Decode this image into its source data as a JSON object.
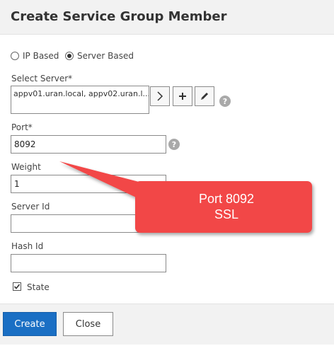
{
  "dialog": {
    "title": "Create Service Group Member"
  },
  "type_selector": {
    "options": [
      {
        "label": "IP Based",
        "selected": false
      },
      {
        "label": "Server Based",
        "selected": true
      }
    ]
  },
  "select_server": {
    "label": "Select Server*",
    "value": "appv01.uran.local, appv02.uran.l..."
  },
  "port": {
    "label": "Port*",
    "value": "8092"
  },
  "weight": {
    "label": "Weight",
    "value": "1"
  },
  "server_id": {
    "label": "Server Id",
    "value": ""
  },
  "hash_id": {
    "label": "Hash Id",
    "value": ""
  },
  "state": {
    "label": "State",
    "checked": true
  },
  "help_icon_glyph": "?",
  "buttons": {
    "create": "Create",
    "close": "Close"
  },
  "annotation": {
    "line1": "Port 8092",
    "line2": "SSL",
    "color": "#f24646"
  },
  "colors": {
    "primary_button": "#1a6fc4",
    "header_bg": "#f2f2f2"
  },
  "icons": [
    "chevron-right-icon",
    "plus-icon",
    "pencil-icon",
    "help-icon",
    "checkmark-icon"
  ]
}
